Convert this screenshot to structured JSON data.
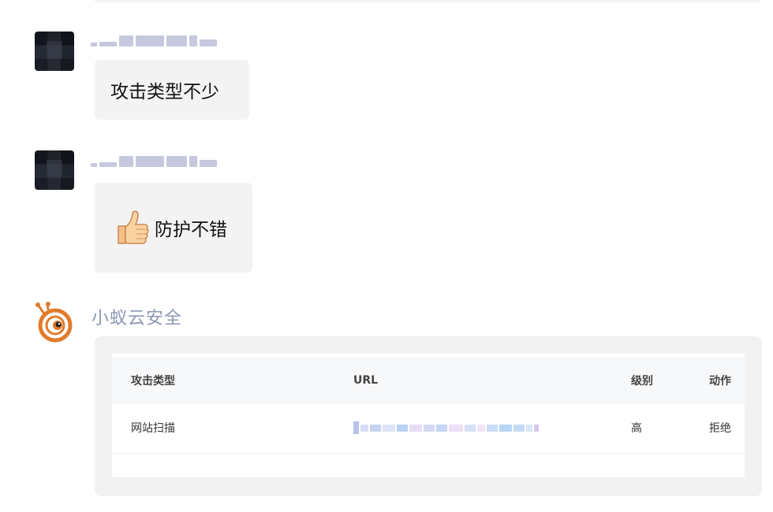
{
  "messages": [
    {
      "text": "攻击类型不少"
    },
    {
      "text": "防护不错",
      "emoji": "thumbs-up-icon"
    }
  ],
  "bot": {
    "name": "小蚁云安全",
    "avatar_icon": "ant-mascot-icon",
    "accent": "#e07b2c"
  },
  "table": {
    "headers": [
      "攻击类型",
      "URL",
      "级别",
      "动作"
    ],
    "rows": [
      {
        "type": "网站扫描",
        "level": "高",
        "action": "拒绝"
      }
    ]
  },
  "colors": {
    "bubble": "#f3f3f3",
    "bot_name": "#8d96b5",
    "card": "#f2f2f2"
  }
}
